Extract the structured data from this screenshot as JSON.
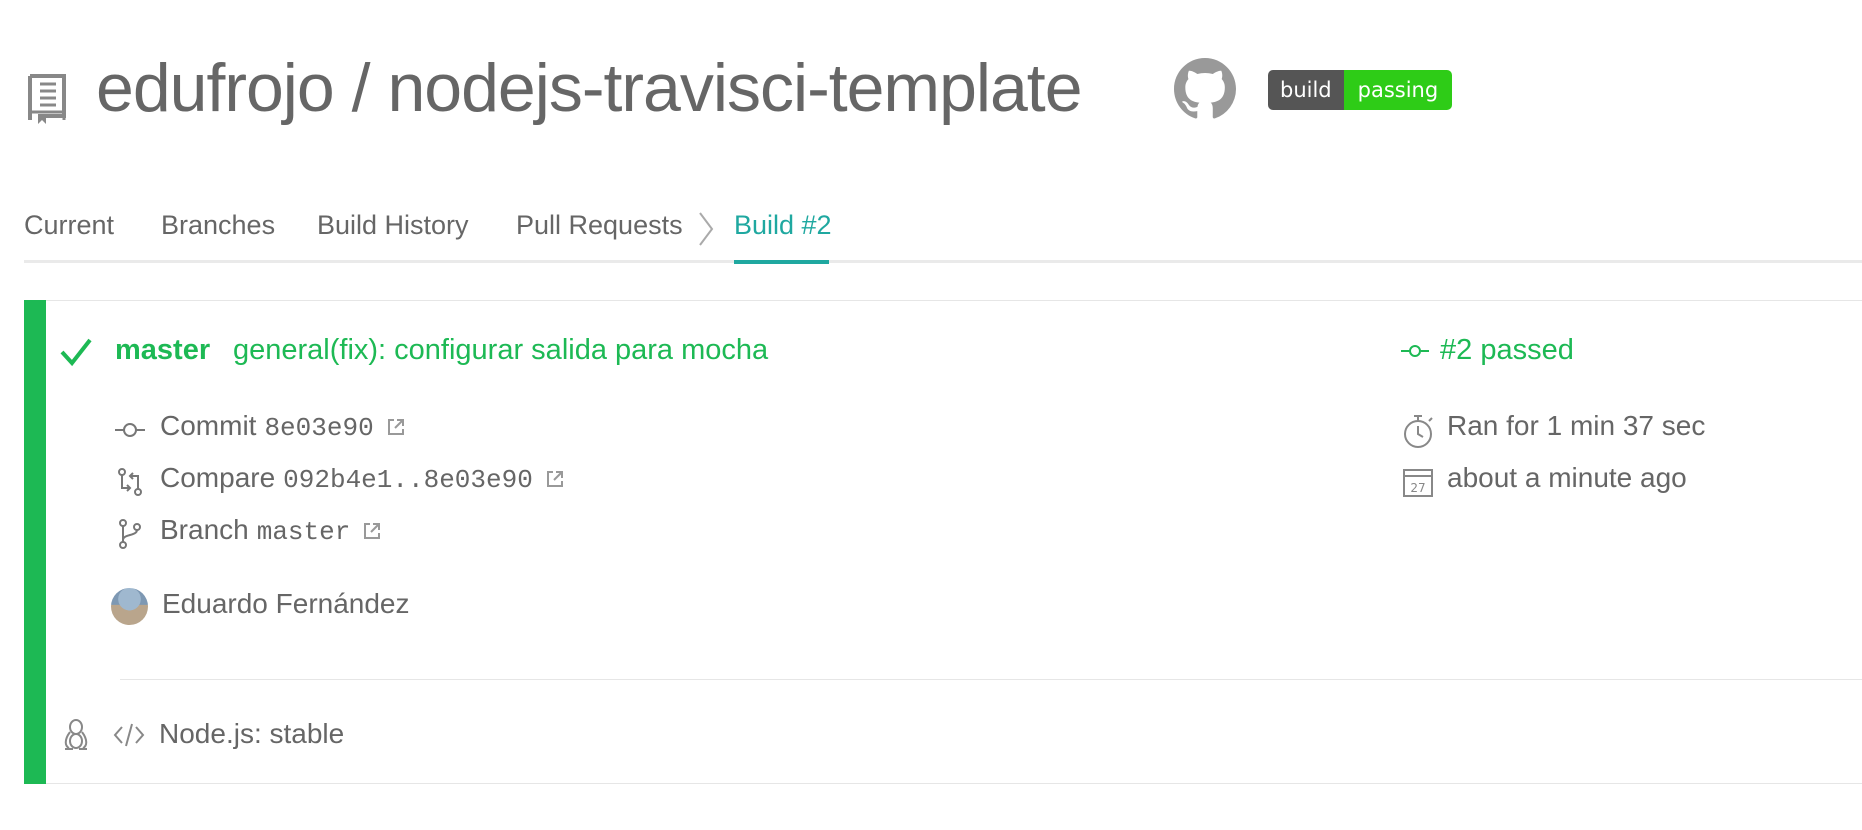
{
  "header": {
    "owner": "edufrojo",
    "separator": "/",
    "repo": "nodejs-travisci-template",
    "icons": {
      "repo": "repo-book-icon",
      "github": "github-octocat-icon"
    },
    "badge": {
      "left": "build",
      "right": "passing",
      "left_color": "#555555",
      "right_color": "#2ecc17"
    }
  },
  "tabs": [
    {
      "label": "Current"
    },
    {
      "label": "Branches"
    },
    {
      "label": "Build History"
    },
    {
      "label": "Pull Requests"
    },
    {
      "label": "Build #2",
      "active": true
    }
  ],
  "build": {
    "status_color": "#1db954",
    "branch": "master",
    "message": "general(fix): configurar salida para mocha",
    "commit_label": "Commit",
    "commit_sha": "8e03e90",
    "compare_label": "Compare",
    "compare_range": "092b4e1..8e03e90",
    "branch_label": "Branch",
    "branch_value": "master",
    "author": "Eduardo Fernández",
    "summary": "#2 passed",
    "duration": "Ran for 1 min 37 sec",
    "finished": "about a minute ago",
    "calendar_day": "27",
    "job": "Node.js: stable"
  },
  "colors": {
    "accent_teal": "#1fa8a0",
    "passed_green": "#1db954",
    "text_gray": "#666666"
  }
}
